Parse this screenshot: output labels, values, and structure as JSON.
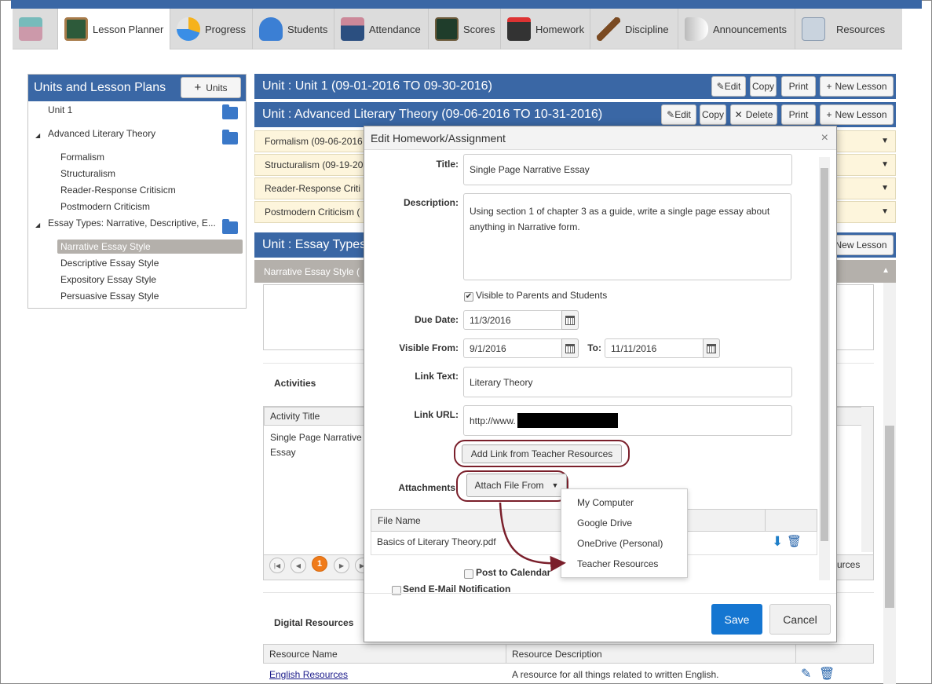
{
  "nav": {
    "tabs": [
      {
        "label": "",
        "icon": "dashboard-icon"
      },
      {
        "label": "Lesson Planner",
        "icon": "chalkboard-icon"
      },
      {
        "label": "Progress",
        "icon": "pie-chart-icon"
      },
      {
        "label": "Students",
        "icon": "people-icon"
      },
      {
        "label": "Attendance",
        "icon": "teacher-icon"
      },
      {
        "label": "Scores",
        "icon": "scores-icon"
      },
      {
        "label": "Homework",
        "icon": "homework-icon"
      },
      {
        "label": "Discipline",
        "icon": "gavel-icon"
      },
      {
        "label": "Announcements",
        "icon": "megaphone-icon"
      },
      {
        "label": "Resources",
        "icon": "books-icon"
      }
    ]
  },
  "sidebar": {
    "title": "Units and Lesson Plans",
    "units_button": "Units",
    "items": [
      {
        "label": "Unit 1"
      },
      {
        "label": "Advanced Literary Theory"
      },
      {
        "label": "Formalism"
      },
      {
        "label": "Structuralism"
      },
      {
        "label": "Reader-Response Critisicm"
      },
      {
        "label": "Postmodern Criticism"
      },
      {
        "label": "Essay Types: Narrative, Descriptive, E..."
      },
      {
        "label": "Narrative Essay Style"
      },
      {
        "label": "Descriptive Essay Style"
      },
      {
        "label": "Expository Essay Style"
      },
      {
        "label": "Persuasive Essay Style"
      }
    ]
  },
  "main": {
    "unit1_title": "Unit : Unit 1  (09-01-2016 TO  09-30-2016)",
    "unit2_title": "Unit : Advanced Literary Theory  (09-06-2016 TO  10-31-2016)",
    "unit3_title": "Unit : Essay Types",
    "buttons": {
      "edit": "Edit",
      "copy": "Copy",
      "delete": "Delete",
      "print": "Print",
      "new_lesson": "New Lesson"
    },
    "lessons": [
      {
        "label": "Formalism (09-06-2016"
      },
      {
        "label": "Structuralism (09-19-20"
      },
      {
        "label": "Reader-Response Criti"
      },
      {
        "label": "Postmodern Criticism ("
      }
    ],
    "active_lesson": "Narrative Essay Style (",
    "activities_heading": "Activities",
    "activity_col": "Activity Title",
    "activity_row": "Single Page Narrative Essay",
    "page_number": "1",
    "resources_tail": "urces",
    "digital_resources_heading": "Digital Resources",
    "resource_cols": [
      "Resource Name",
      "Resource Description"
    ],
    "resource_row": {
      "name": "English Resources",
      "description": "A resource for all things related to written English."
    }
  },
  "modal": {
    "title": "Edit Homework/Assignment",
    "labels": {
      "title": "Title:",
      "description": "Description:",
      "due_date": "Due Date:",
      "visible_from": "Visible From:",
      "to": "To:",
      "link_text": "Link Text:",
      "link_url": "Link URL:",
      "attachments": "Attachments:"
    },
    "title_value": "Single Page Narrative Essay",
    "description_value": "Using section 1 of chapter 3 as a guide, write a single page essay about anything in Narrative form.",
    "visible_checkbox": "Visible to Parents and Students",
    "due_date": "11/3/2016",
    "visible_from": "9/1/2016",
    "visible_to": "11/11/2016",
    "link_text": "Literary Theory",
    "link_url": "http://www.",
    "add_link_button": "Add Link from Teacher Resources",
    "attach_button": "Attach File From",
    "file_col": "File Name",
    "file_row": "Basics of Literary Theory.pdf",
    "post_calendar": "Post to Calendar",
    "send_email": "Send E-Mail Notification",
    "save": "Save",
    "cancel": "Cancel",
    "attach_options": [
      "My Computer",
      "Google Drive",
      "OneDrive (Personal)",
      "Teacher Resources"
    ]
  },
  "colors": {
    "header_blue": "#3a67a5",
    "save_blue": "#1576d1",
    "highlight_ring": "#7a1f2b",
    "lesson_row": "#fdf5dc"
  }
}
